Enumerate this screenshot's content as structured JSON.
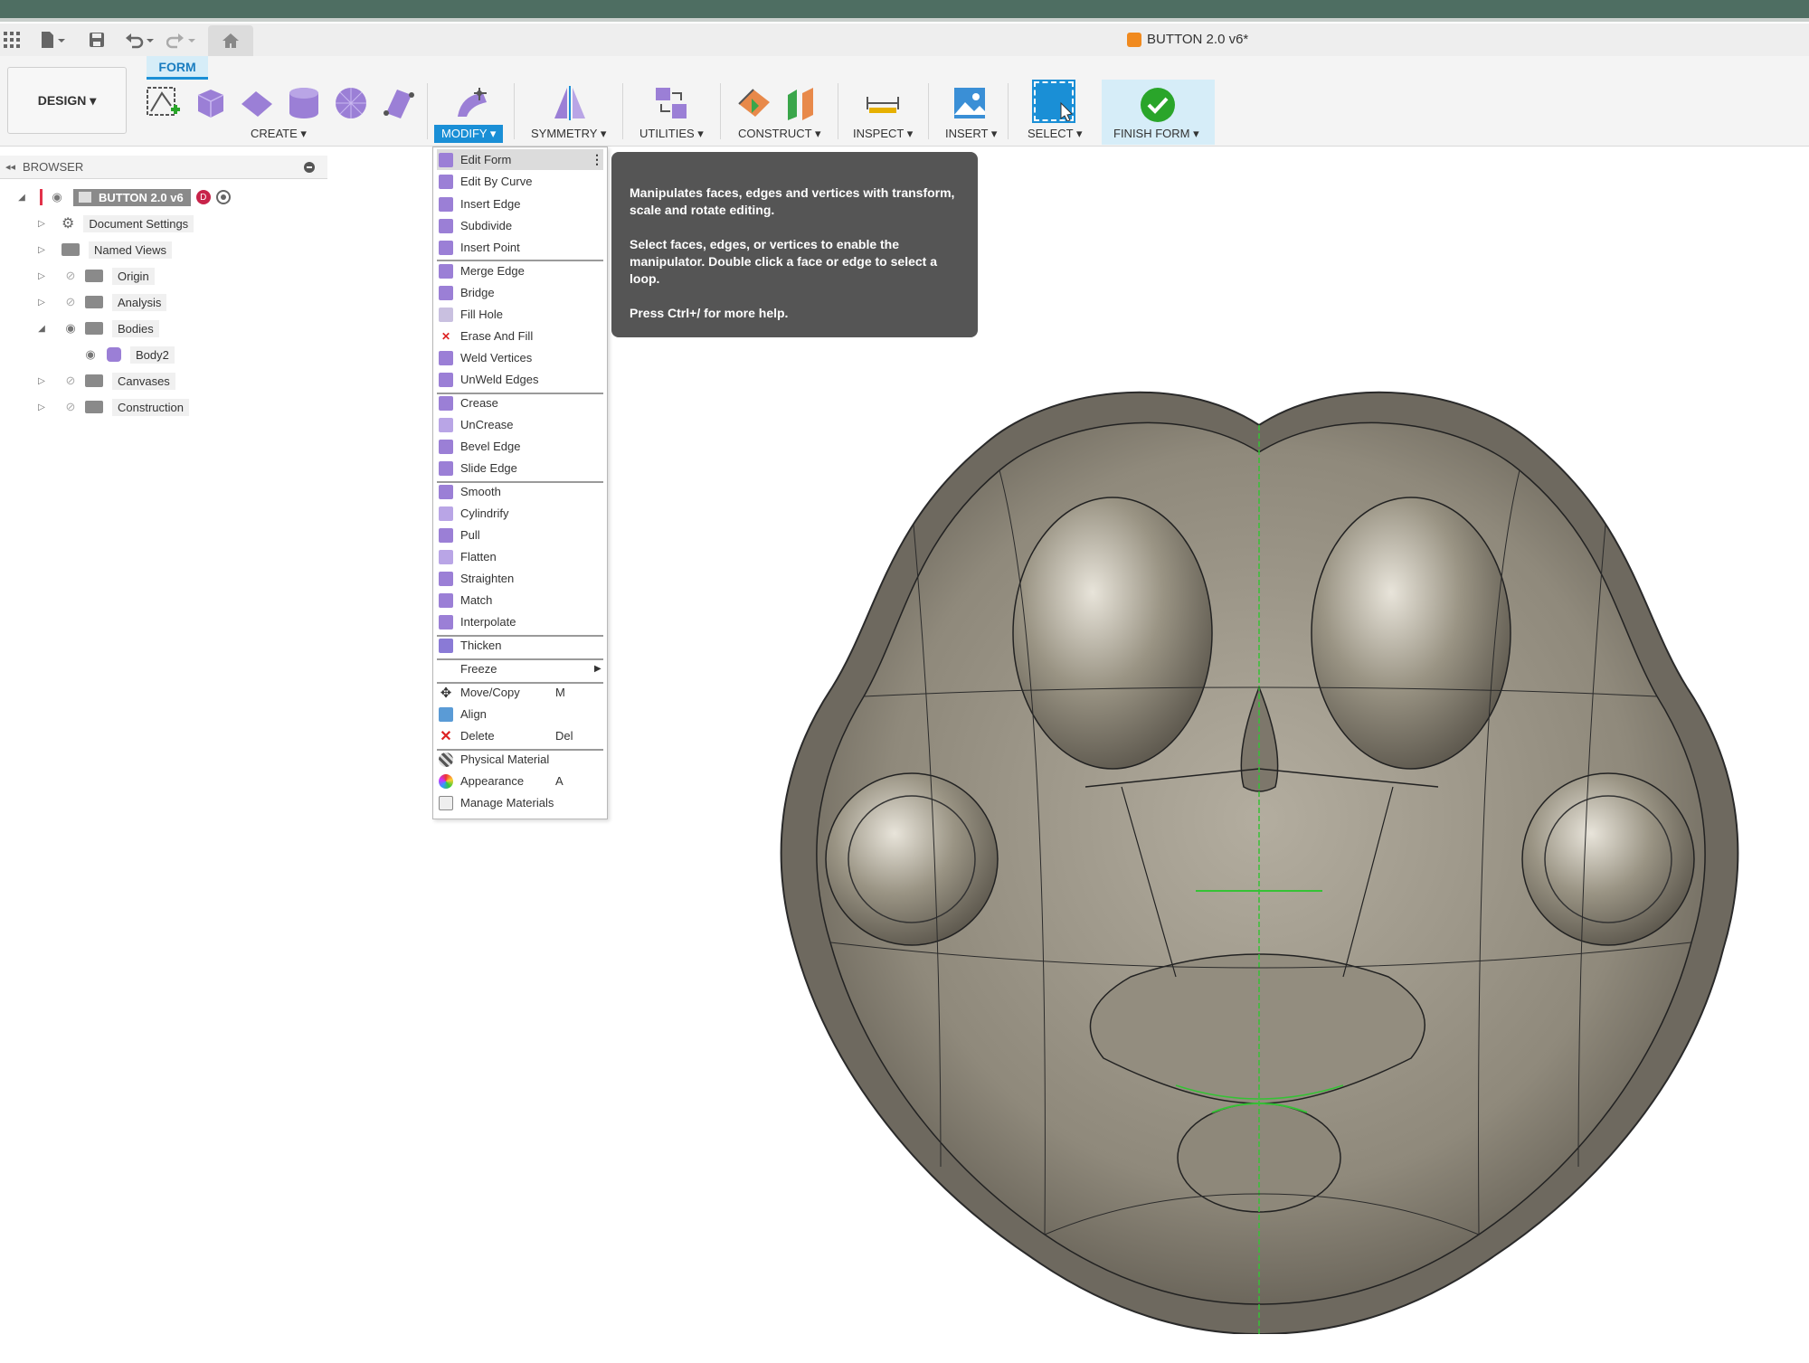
{
  "window": {
    "title": "BUTTON 2.0 v6*"
  },
  "workspace": {
    "design_label": "DESIGN ▾",
    "active_tab": "FORM"
  },
  "ribbon_groups": {
    "create": "CREATE ▾",
    "modify": "MODIFY ▾",
    "symmetry": "SYMMETRY ▾",
    "utilities": "UTILITIES ▾",
    "construct": "CONSTRUCT ▾",
    "inspect": "INSPECT ▾",
    "insert": "INSERT ▾",
    "select": "SELECT ▾",
    "finish_form": "FINISH FORM ▾"
  },
  "browser": {
    "title": "BROWSER",
    "root": "BUTTON 2.0 v6",
    "items": [
      {
        "label": "Document Settings"
      },
      {
        "label": "Named Views"
      },
      {
        "label": "Origin"
      },
      {
        "label": "Analysis"
      },
      {
        "label": "Bodies"
      },
      {
        "label": "Body2"
      },
      {
        "label": "Canvases"
      },
      {
        "label": "Construction"
      }
    ]
  },
  "modify_menu": {
    "items": [
      {
        "label": "Edit Form"
      },
      {
        "label": "Edit By Curve"
      },
      {
        "label": "Insert Edge"
      },
      {
        "label": "Subdivide"
      },
      {
        "label": "Insert Point"
      },
      {
        "label": "Merge Edge"
      },
      {
        "label": "Bridge"
      },
      {
        "label": "Fill Hole"
      },
      {
        "label": "Erase And Fill"
      },
      {
        "label": "Weld Vertices"
      },
      {
        "label": "UnWeld Edges"
      },
      {
        "label": "Crease"
      },
      {
        "label": "UnCrease"
      },
      {
        "label": "Bevel Edge"
      },
      {
        "label": "Slide Edge"
      },
      {
        "label": "Smooth"
      },
      {
        "label": "Cylindrify"
      },
      {
        "label": "Pull"
      },
      {
        "label": "Flatten"
      },
      {
        "label": "Straighten"
      },
      {
        "label": "Match"
      },
      {
        "label": "Interpolate"
      },
      {
        "label": "Thicken"
      },
      {
        "label": "Freeze"
      },
      {
        "label": "Move/Copy",
        "shortcut": "M"
      },
      {
        "label": "Align"
      },
      {
        "label": "Delete",
        "shortcut": "Del"
      },
      {
        "label": "Physical Material"
      },
      {
        "label": "Appearance",
        "shortcut": "A"
      },
      {
        "label": "Manage Materials"
      }
    ]
  },
  "tooltip": {
    "line1": "Manipulates faces, edges and vertices with transform, scale and rotate editing.",
    "line2": "Select faces, edges, or vertices to enable the manipulator. Double click a face or edge to select a loop.",
    "line3": "Press Ctrl+/ for more help."
  },
  "colors": {
    "accent": "#1a8fd6",
    "form_purple": "#9b7fd6",
    "titlebar": "#4e6e62",
    "body_metal": "#8a8478",
    "symmetry_line": "#35c235"
  }
}
